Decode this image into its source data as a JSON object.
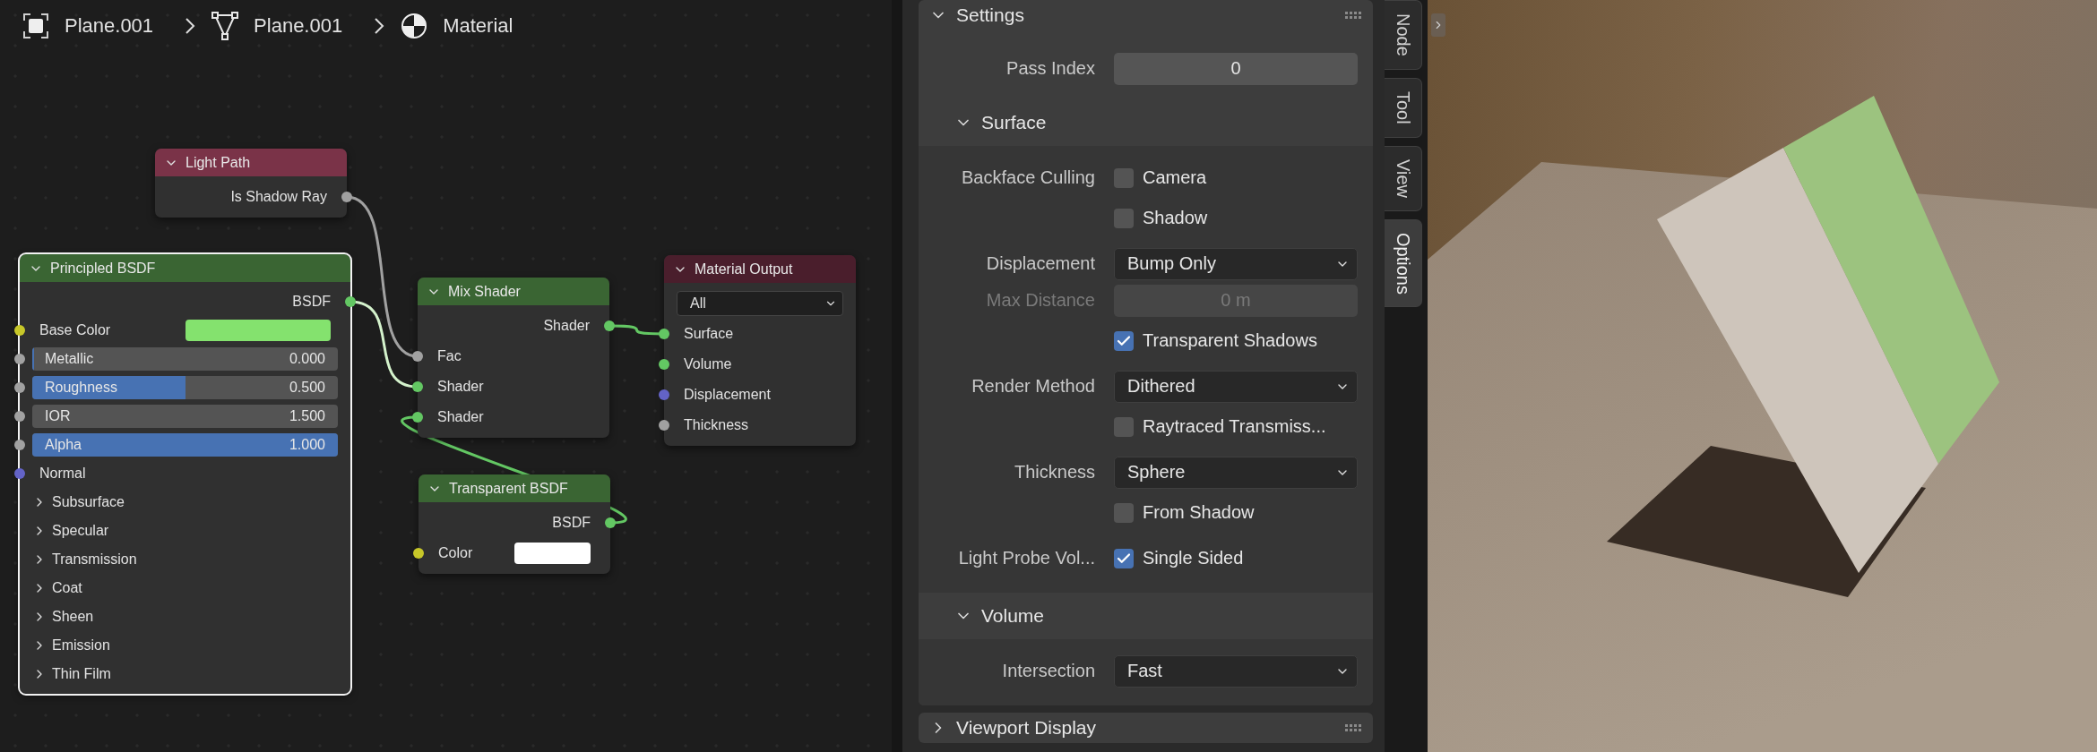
{
  "breadcrumbs": [
    {
      "kind": "object",
      "label": "Plane.001"
    },
    {
      "kind": "mesh",
      "label": "Plane.001"
    },
    {
      "kind": "material",
      "label": "Material"
    }
  ],
  "nodes": [
    {
      "title": "Light Path",
      "color": "#7a3348",
      "selected": false,
      "rows": [
        {
          "kind": "output",
          "label": "Is Shadow Ray",
          "color": "#a1a1a1"
        }
      ]
    },
    {
      "title": "Principled BSDF",
      "color": "#3a6533",
      "selected": true,
      "rows": [
        {
          "kind": "output",
          "label": "BSDF",
          "color": "#63c763"
        },
        {
          "kind": "color",
          "label": "Base Color",
          "color": "#c7c729",
          "swatch": {
            "color": "#84e26e"
          }
        },
        {
          "kind": "slider",
          "label": "Metallic",
          "value": "0.000",
          "level": 0,
          "color": "#a1a1a1"
        },
        {
          "kind": "slider",
          "label": "Roughness",
          "value": "0.500",
          "level": 0.5,
          "color": "#a1a1a1"
        },
        {
          "kind": "number",
          "label": "IOR",
          "value": "1.500",
          "color": "#a1a1a1"
        },
        {
          "kind": "slider",
          "label": "Alpha",
          "value": "1.000",
          "level": 1,
          "color": "#a1a1a1"
        },
        {
          "kind": "input",
          "label": "Normal",
          "color": "#6363c7"
        },
        {
          "kind": "panel",
          "label": "Subsurface",
          "expanded": false
        },
        {
          "kind": "panel",
          "label": "Specular",
          "expanded": false
        },
        {
          "kind": "panel",
          "label": "Transmission",
          "expanded": false
        },
        {
          "kind": "panel",
          "label": "Coat",
          "expanded": false
        },
        {
          "kind": "panel",
          "label": "Sheen",
          "expanded": false
        },
        {
          "kind": "panel",
          "label": "Emission",
          "expanded": false
        },
        {
          "kind": "panel",
          "label": "Thin Film",
          "expanded": false
        }
      ]
    },
    {
      "title": "Mix Shader",
      "color": "#3a6533",
      "selected": false,
      "rows": [
        {
          "kind": "output",
          "label": "Shader",
          "color": "#63c763"
        },
        {
          "kind": "input",
          "label": "Fac",
          "color": "#a1a1a1"
        },
        {
          "kind": "input",
          "label": "Shader",
          "color": "#63c763"
        },
        {
          "kind": "input",
          "label": "Shader",
          "color": "#63c763"
        }
      ]
    },
    {
      "title": "Material Output",
      "color": "#4a1e2c",
      "selected": false,
      "rows": [
        {
          "kind": "dropdown",
          "value": "All"
        },
        {
          "kind": "input",
          "label": "Surface",
          "color": "#63c763"
        },
        {
          "kind": "input",
          "label": "Volume",
          "color": "#63c763"
        },
        {
          "kind": "input",
          "label": "Displacement",
          "color": "#6363c7"
        },
        {
          "kind": "input",
          "label": "Thickness",
          "color": "#a1a1a1"
        }
      ]
    },
    {
      "title": "Transparent BSDF",
      "color": "#3a6533",
      "selected": false,
      "rows": [
        {
          "kind": "output",
          "label": "BSDF",
          "color": "#63c763"
        },
        {
          "kind": "color",
          "label": "Color",
          "color": "#c7c729",
          "swatch": {
            "color": "#ffffff"
          }
        }
      ]
    }
  ],
  "properties": {
    "sections": [
      {
        "title": "Settings",
        "expanded": true,
        "rows": [
          {
            "kind": "number",
            "label": "Pass Index",
            "value": "0",
            "disabled": false
          }
        ],
        "subsections": [
          {
            "title": "Surface",
            "expanded": true,
            "rows": [
              {
                "kind": "checkbox",
                "label": "Backface Culling",
                "text": "Camera",
                "checked": false
              },
              {
                "kind": "checkbox",
                "text": "Shadow",
                "checked": false
              },
              {
                "kind": "dropdown",
                "label": "Displacement",
                "value": "Bump Only"
              },
              {
                "kind": "number",
                "label": "Max Distance",
                "value": "0 m",
                "disabled": true
              },
              {
                "kind": "checkbox",
                "text": "Transparent Shadows",
                "checked": true
              },
              {
                "kind": "dropdown",
                "label": "Render Method",
                "value": "Dithered"
              },
              {
                "kind": "checkbox",
                "text": "Raytraced Transmiss...",
                "checked": false
              },
              {
                "kind": "dropdown",
                "label": "Thickness",
                "value": "Sphere"
              },
              {
                "kind": "checkbox",
                "text": "From Shadow",
                "checked": false
              },
              {
                "kind": "checkbox",
                "label": "Light Probe Vol...",
                "text": "Single Sided",
                "checked": true
              }
            ]
          },
          {
            "title": "Volume",
            "expanded": true,
            "rows": [
              {
                "kind": "dropdown",
                "label": "Intersection",
                "value": "Fast"
              }
            ]
          }
        ]
      },
      {
        "title": "Viewport Display",
        "expanded": false
      }
    ]
  },
  "sidebar_tabs": [
    {
      "label": "Node",
      "selected": false
    },
    {
      "label": "Tool",
      "selected": false
    },
    {
      "label": "View",
      "selected": false
    },
    {
      "label": "Options",
      "selected": true
    }
  ]
}
